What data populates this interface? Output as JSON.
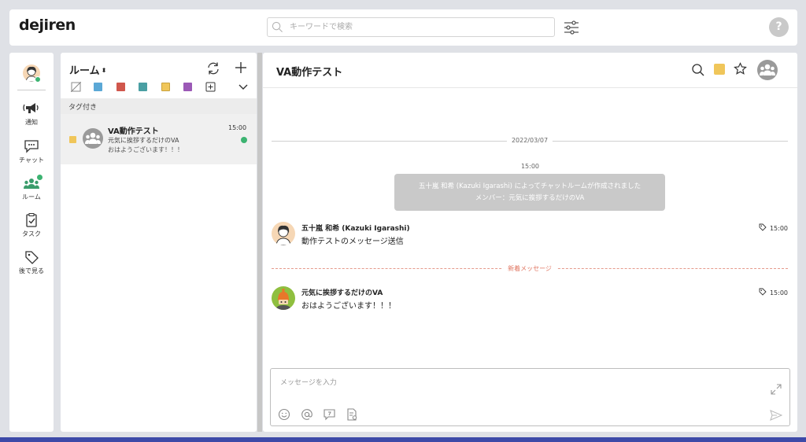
{
  "header": {
    "logo": "dejiren",
    "search_placeholder": "キーワードで検索",
    "help_label": "?"
  },
  "nav": {
    "items": [
      {
        "label": "通知",
        "icon": "megaphone-icon"
      },
      {
        "label": "チャット",
        "icon": "chat-icon"
      },
      {
        "label": "ルーム",
        "icon": "room-icon"
      },
      {
        "label": "タスク",
        "icon": "task-icon"
      },
      {
        "label": "後で見る",
        "icon": "tag-icon"
      }
    ]
  },
  "roomlist": {
    "title": "ルーム",
    "sort_glyph": "⬍",
    "tag_colors": [
      "#5ba8d6",
      "#d0574c",
      "#4a9fa3",
      "#f0c65a",
      "#9b59b6"
    ],
    "section": "タグ付き",
    "rooms": [
      {
        "name": "VA動作テスト",
        "time": "15:00",
        "sender": "元気に挨拶するだけのVA",
        "preview": "おはようございます！！！",
        "tag_color": "#f0c65a"
      }
    ]
  },
  "chat": {
    "title": "VA動作テスト",
    "date_separator": "2022/03/07",
    "system_time": "15:00",
    "system_line1": "五十嵐 和希 (Kazuki Igarashi) によってチャットルームが作成されました",
    "system_line2": "メンバー：元気に挨拶するだけのVA",
    "new_separator": "新着メッセージ",
    "messages": [
      {
        "sender": "五十嵐 和希 (Kazuki Igarashi)",
        "text": "動作テストのメッセージ送信",
        "time": "15:00"
      },
      {
        "sender": "元気に挨拶するだけのVA",
        "text": "おはようございます！！！",
        "time": "15:00"
      }
    ],
    "composer_placeholder": "メッセージを入力"
  },
  "colors": {
    "accent_green": "#3cb371",
    "tag_yellow": "#f0c65a",
    "new_message": "#e07560"
  }
}
